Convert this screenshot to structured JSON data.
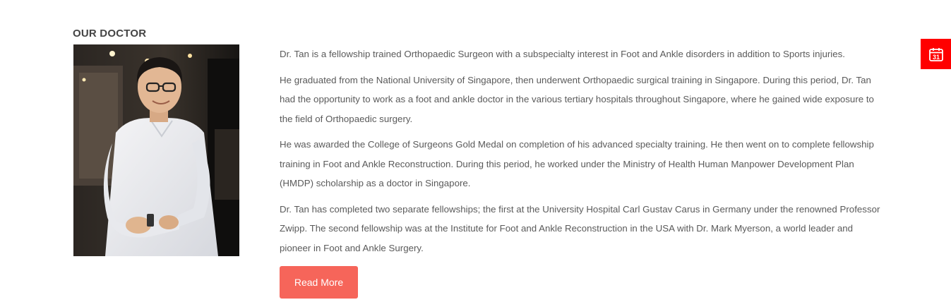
{
  "section": {
    "title": "OUR DOCTOR"
  },
  "photo": {
    "alt": "Dr. Tan"
  },
  "bio": {
    "paragraphs": [
      "Dr. Tan is a fellowship trained Orthopaedic Surgeon with a subspecialty interest in Foot and Ankle disorders in addition to Sports injuries.",
      "He graduated from the National University of Singapore, then underwent Orthopaedic surgical training in Singapore. During this period, Dr. Tan had the opportunity to work as a foot and ankle doctor in the various tertiary hospitals throughout Singapore, where he gained wide exposure to the field of Orthopaedic surgery.",
      "He was awarded the College of Surgeons Gold Medal on completion of his advanced specialty training. He then went on to complete fellowship training in Foot and Ankle Reconstruction. During this period, he worked under the Ministry of Health Human Manpower Development Plan (HMDP) scholarship as a doctor in Singapore.",
      "Dr. Tan has completed two separate fellowships; the first at the University Hospital Carl Gustav Carus in Germany under the renowned Professor Zwipp. The second fellowship was at the Institute for Foot and Ankle Reconstruction in the USA with Dr. Mark Myerson, a world leader and pioneer in Foot and Ankle Surgery."
    ]
  },
  "actions": {
    "read_more_label": "Read More"
  },
  "appointment": {
    "icon": "calendar-icon",
    "day": "31"
  },
  "colors": {
    "button": "#f6655a",
    "appointment_tab": "#ff0000",
    "text": "#5a5a5a",
    "heading": "#444444"
  }
}
